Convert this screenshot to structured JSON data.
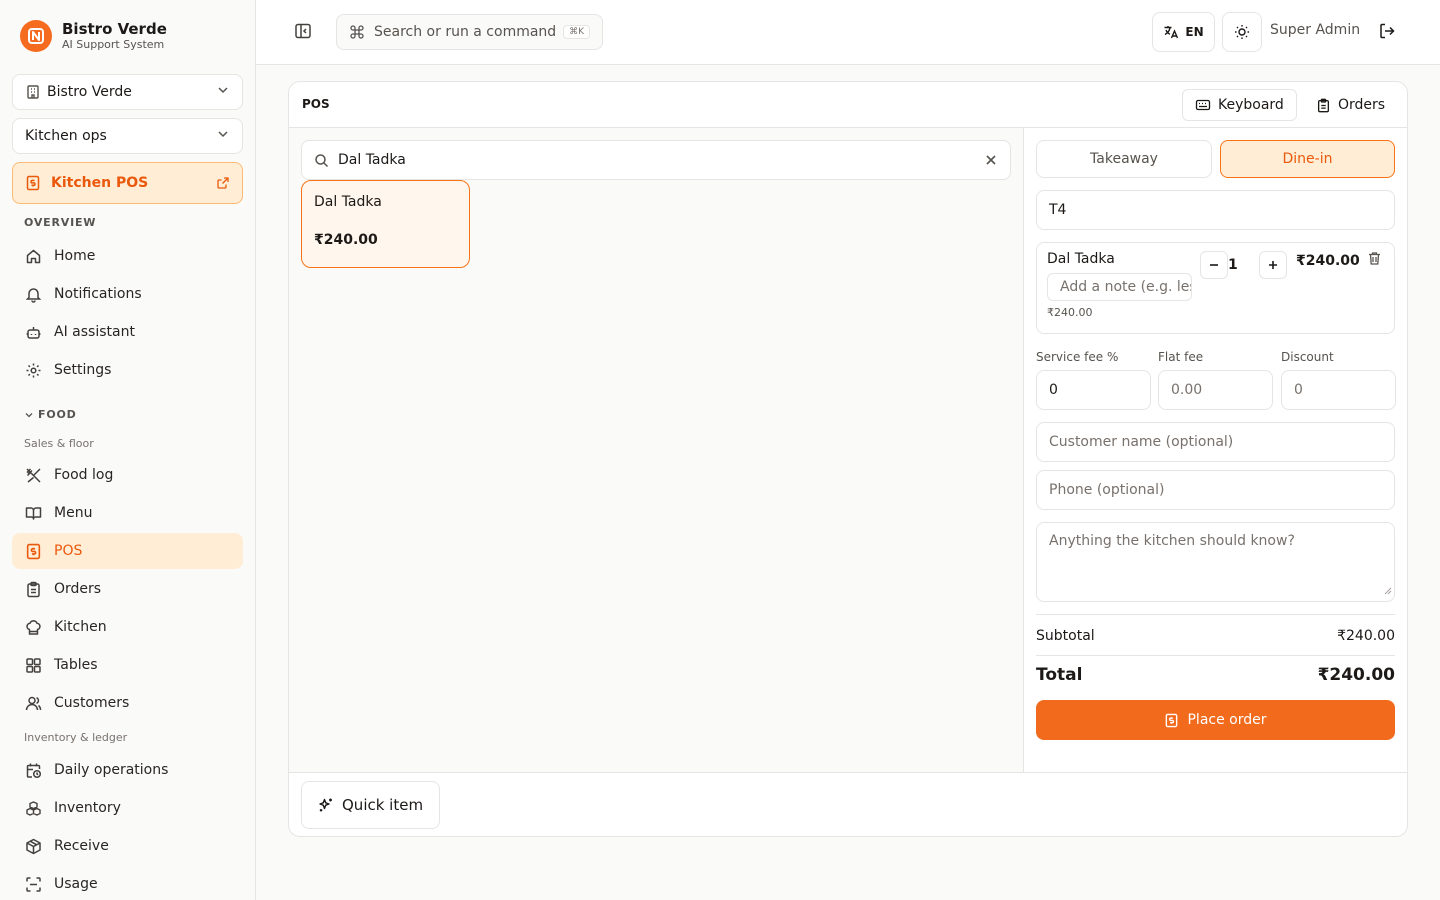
{
  "brand": {
    "name": "Bistro Verde",
    "subtitle": "AI Support System"
  },
  "sidebar": {
    "location_select": "Bistro Verde",
    "workspace_select": "Kitchen ops",
    "kitchen_pos_link": "Kitchen POS",
    "section_overview": "OVERVIEW",
    "overview_items": [
      {
        "label": "Home",
        "icon": "home-icon"
      },
      {
        "label": "Notifications",
        "icon": "bell-icon"
      },
      {
        "label": "AI assistant",
        "icon": "bot-icon"
      },
      {
        "label": "Settings",
        "icon": "gear-icon"
      }
    ],
    "section_food": "FOOD",
    "group_sales": "Sales & floor",
    "sales_items": [
      {
        "label": "Food log",
        "icon": "utensils-icon"
      },
      {
        "label": "Menu",
        "icon": "book-icon"
      },
      {
        "label": "POS",
        "icon": "pos-icon",
        "active": true
      },
      {
        "label": "Orders",
        "icon": "clipboard-icon"
      },
      {
        "label": "Kitchen",
        "icon": "chef-hat-icon"
      },
      {
        "label": "Tables",
        "icon": "grid-icon"
      },
      {
        "label": "Customers",
        "icon": "users-icon"
      }
    ],
    "group_inventory": "Inventory & ledger",
    "inventory_items": [
      {
        "label": "Daily operations",
        "icon": "calendar-clock-icon"
      },
      {
        "label": "Inventory",
        "icon": "boxes-icon"
      },
      {
        "label": "Receive",
        "icon": "package-icon"
      },
      {
        "label": "Usage",
        "icon": "scan-icon"
      }
    ]
  },
  "topbar": {
    "command_placeholder": "Search or run a command",
    "command_shortcut": "⌘K",
    "language": "EN",
    "user_name": "Super Admin"
  },
  "pos": {
    "title": "POS",
    "keyboard_button": "Keyboard",
    "orders_button": "Orders",
    "search_value": "Dal Tadka",
    "results": [
      {
        "name": "Dal Tadka",
        "price": "₹240.00"
      }
    ],
    "order_type": {
      "takeaway": "Takeaway",
      "dine_in": "Dine-in",
      "selected": "Dine-in"
    },
    "table_value": "T4",
    "line_items": [
      {
        "name": "Dal Tadka",
        "note_placeholder": "Add a note (e.g. less spicy)",
        "unit_price": "₹240.00",
        "qty": "1",
        "total": "₹240.00"
      }
    ],
    "labels": {
      "service_fee": "Service fee %",
      "flat_fee": "Flat fee",
      "discount": "Discount"
    },
    "values": {
      "service_fee": "0",
      "flat_fee_placeholder": "0.00",
      "discount_placeholder": "0"
    },
    "customer_placeholder": "Customer name (optional)",
    "phone_placeholder": "Phone (optional)",
    "kitchen_note_placeholder": "Anything the kitchen should know?",
    "subtotal_label": "Subtotal",
    "subtotal_value": "₹240.00",
    "total_label": "Total",
    "total_value": "₹240.00",
    "place_order": "Place order",
    "quick_item": "Quick item"
  },
  "colors": {
    "accent": "#f26b1d",
    "accent_soft": "#ffedd5",
    "border": "#e7e5e4"
  }
}
